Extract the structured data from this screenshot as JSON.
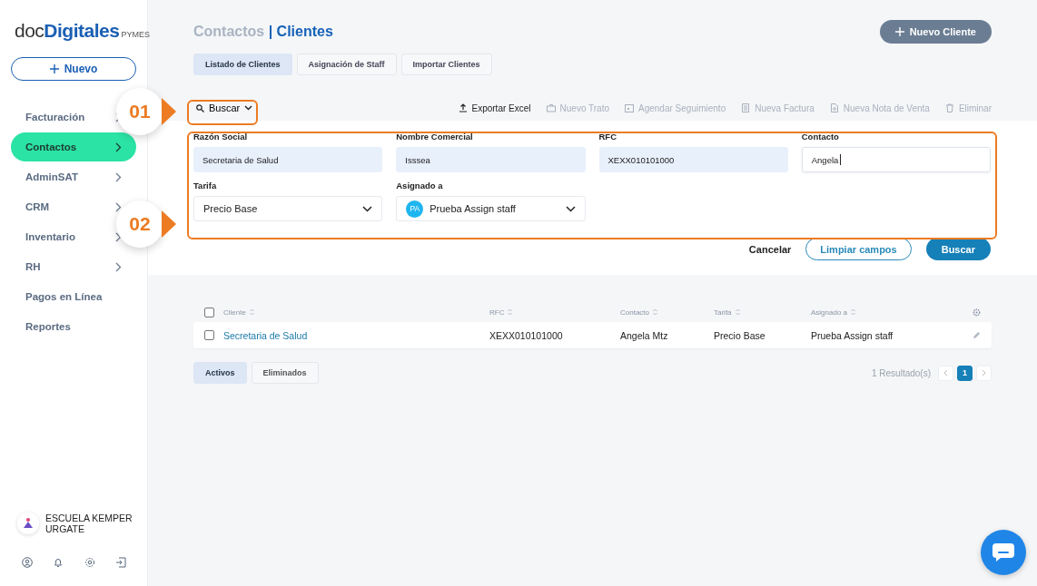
{
  "logo": {
    "prefix": "doc",
    "brand": "Digitales",
    "suffix": "PYMES"
  },
  "new_button": "Nuevo",
  "sidebar": {
    "items": [
      {
        "label": "Facturación",
        "selected": false,
        "expandable": true
      },
      {
        "label": "Contactos",
        "selected": true,
        "expandable": true
      },
      {
        "label": "AdminSAT",
        "selected": false,
        "expandable": true
      },
      {
        "label": "CRM",
        "selected": false,
        "expandable": true
      },
      {
        "label": "Inventario",
        "selected": false,
        "expandable": true
      },
      {
        "label": "RH",
        "selected": false,
        "expandable": true
      },
      {
        "label": "Pagos en Línea",
        "selected": false,
        "expandable": false
      },
      {
        "label": "Reportes",
        "selected": false,
        "expandable": false
      }
    ]
  },
  "account": {
    "name": "ESCUELA KEMPER URGATE"
  },
  "header": {
    "breadcrumb": [
      "Contactos",
      "Clientes"
    ],
    "separator": "|",
    "primary_button": "Nuevo Cliente"
  },
  "tabs": [
    {
      "label": "Listado de Clientes",
      "selected": true
    },
    {
      "label": "Asignación de Staff",
      "selected": false
    },
    {
      "label": "Importar Clientes",
      "selected": false
    }
  ],
  "toolbar": {
    "search_toggle": "Buscar",
    "actions": [
      {
        "label": "Exportar Excel",
        "disabled": false
      },
      {
        "label": "Nuevo Trato",
        "disabled": true
      },
      {
        "label": "Agendar Seguimiento",
        "disabled": true
      },
      {
        "label": "Nueva Factura",
        "disabled": true
      },
      {
        "label": "Nueva Nota de Venta",
        "disabled": true
      },
      {
        "label": "Eliminar",
        "disabled": true
      }
    ]
  },
  "filters": [
    {
      "label": "Razón Social",
      "kind": "text",
      "value": "Secretaria de Salud",
      "focused": false
    },
    {
      "label": "Nombre Comercial",
      "kind": "text",
      "value": "Isssea",
      "focused": false
    },
    {
      "label": "RFC",
      "kind": "text",
      "value": "XEXX010101000",
      "focused": false
    },
    {
      "label": "Contacto",
      "kind": "text",
      "value": "Angela",
      "focused": true
    },
    {
      "label": "Tarifa",
      "kind": "select",
      "value": "Precio Base"
    },
    {
      "label": "Asignado a",
      "kind": "select",
      "value": "Prueba Assign staff",
      "avatar": "PA"
    }
  ],
  "form_buttons": [
    {
      "label": "Cancelar",
      "kind": "text"
    },
    {
      "label": "Limpiar campos",
      "kind": "outline"
    },
    {
      "label": "Buscar",
      "kind": "primary"
    }
  ],
  "table": {
    "select_all_checked": false,
    "columns": [
      "Cliente",
      "RFC",
      "Contacto",
      "Tarifa",
      "Asignado a"
    ],
    "rows": [
      {
        "checked": false,
        "cells": [
          "Secretaria de Salud",
          "XEXX010101000",
          "Angela Mtz",
          "Precio Base",
          "Prueba Assign staff"
        ]
      }
    ]
  },
  "status_tabs": [
    {
      "label": "Activos",
      "selected": true
    },
    {
      "label": "Eliminados",
      "selected": false
    }
  ],
  "pagination": {
    "summary": "1 Resultado(s)",
    "pages": [
      {
        "label": "1",
        "selected": true
      }
    ]
  },
  "annotations": [
    {
      "number": "01"
    },
    {
      "number": "02"
    }
  ]
}
